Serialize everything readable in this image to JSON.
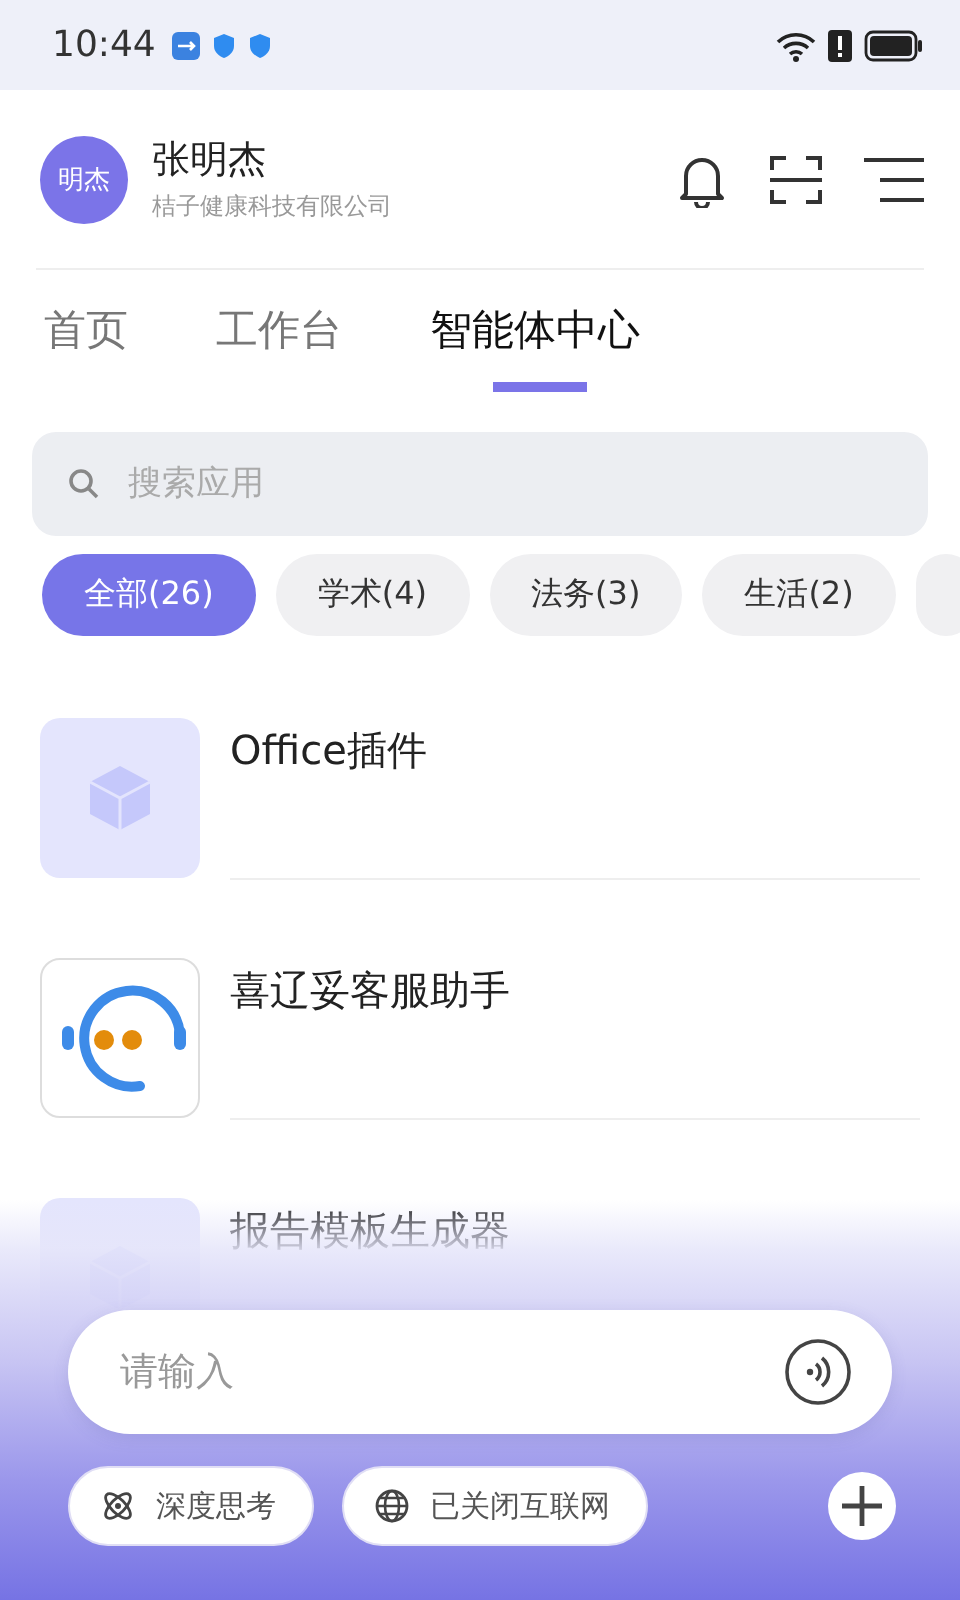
{
  "status_bar": {
    "time": "10:44"
  },
  "header": {
    "avatar": "明杰",
    "name": "张明杰",
    "company": "桔子健康科技有限公司"
  },
  "tabs": [
    {
      "label": "首页",
      "selected": false
    },
    {
      "label": "工作台",
      "selected": false
    },
    {
      "label": "智能体中心",
      "selected": true
    }
  ],
  "search": {
    "placeholder": "搜索应用"
  },
  "filters": [
    {
      "label": "全部(26)",
      "selected": true
    },
    {
      "label": "学术(4)",
      "selected": false
    },
    {
      "label": "法务(3)",
      "selected": false
    },
    {
      "label": "生活(2)",
      "selected": false
    }
  ],
  "apps": [
    {
      "name": "Office插件",
      "kind": "cube"
    },
    {
      "name": "喜辽妥客服助手",
      "kind": "headset"
    },
    {
      "name": "报告模板生成器",
      "kind": "cube"
    }
  ],
  "composer": {
    "placeholder": "请输入",
    "options": [
      "深度思考",
      "已关闭互联网"
    ]
  }
}
